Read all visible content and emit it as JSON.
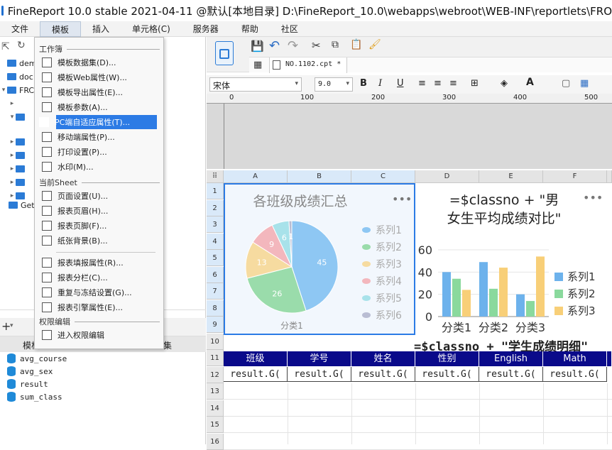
{
  "window": {
    "title": "FineReport 10.0 stable 2021-04-11 @默认[本地目录]    D:\\FineReport_10.0\\webapps\\webroot\\WEB-INF\\reportlets\\FRO"
  },
  "menubar": [
    "文件",
    "模板",
    "插入",
    "单元格(C)",
    "服务器",
    "帮助",
    "社区"
  ],
  "tree": [
    {
      "label": "dem"
    },
    {
      "label": "doc"
    },
    {
      "label": "FRC"
    },
    {
      "label": ""
    },
    {
      "label": ""
    },
    {
      "label": ""
    },
    {
      "label": ""
    },
    {
      "label": ""
    },
    {
      "label": ""
    },
    {
      "label": ""
    },
    {
      "label": "Get"
    }
  ],
  "datasets": {
    "tab1": "模板",
    "tab2": "集",
    "items": [
      "avg_course",
      "avg_sex",
      "result",
      "sum_class"
    ]
  },
  "dropdown": {
    "sections": [
      "工作簿",
      "当前Sheet",
      "权限编辑"
    ],
    "workbook_items": [
      {
        "label": "模板数据集(D)...",
        "icon": "database-icon"
      },
      {
        "label": "模板Web属性(W)...",
        "icon": "globe-icon"
      },
      {
        "label": "模板导出属性(E)...",
        "icon": "export-icon"
      },
      {
        "label": "模板参数(A)...",
        "icon": "param-icon"
      },
      {
        "label": "PC端自适应属性(T)...",
        "icon": "resize-icon"
      },
      {
        "label": "移动端属性(P)...",
        "icon": "mobile-icon"
      },
      {
        "label": "打印设置(P)...",
        "icon": "printer-icon"
      },
      {
        "label": "水印(M)...",
        "icon": "stamp-icon"
      }
    ],
    "sheet_items": [
      {
        "label": "页面设置(U)...",
        "icon": "page-icon"
      },
      {
        "label": "报表页眉(H)...",
        "icon": "header-icon"
      },
      {
        "label": "报表页脚(F)...",
        "icon": "footer-icon"
      },
      {
        "label": "纸张背景(B)...",
        "icon": "image-icon"
      },
      {
        "label": "报表填报属性(R)...",
        "icon": "form-icon"
      },
      {
        "label": "报表分栏(C)...",
        "icon": "columns-icon"
      },
      {
        "label": "重复与冻结设置(G)...",
        "icon": "freeze-icon"
      },
      {
        "label": "报表引擎属性(E)...",
        "icon": "engine-icon"
      }
    ],
    "perm_items": [
      {
        "label": "进入权限编辑",
        "icon": "grid-icon"
      }
    ]
  },
  "editor": {
    "tab": "NO.1102.cpt *",
    "font": "宋体",
    "size": "9.0",
    "ruler": [
      "0",
      "100",
      "200",
      "300",
      "400",
      "500"
    ]
  },
  "columns": [
    "A",
    "B",
    "C",
    "D",
    "E",
    "F"
  ],
  "rows": [
    "1",
    "2",
    "3",
    "4",
    "5",
    "6",
    "7",
    "8",
    "9",
    "10",
    "11",
    "12",
    "13",
    "14",
    "15",
    "16"
  ],
  "cells": {
    "title_formula": "=$classno + \"学生成绩明细\"",
    "headers": [
      "班级",
      "学号",
      "姓名",
      "性别",
      "English",
      "Math"
    ],
    "data": [
      "result.G(",
      "result.G(",
      "result.G(",
      "result.G(",
      "result.G(",
      "result.G("
    ]
  },
  "chart_data": [
    {
      "type": "pie",
      "title": "各班级成绩汇总",
      "categories": [
        "系列1",
        "系列2",
        "系列3",
        "系列4",
        "系列5",
        "系列6"
      ],
      "values": [
        45,
        26,
        13,
        9,
        6,
        1
      ],
      "xlabel": "分类1",
      "colors": [
        "#8ec7f3",
        "#9adcab",
        "#f6dba0",
        "#f3b7bd",
        "#a8e2ea",
        "#b9bdd3"
      ],
      "legend": "right"
    },
    {
      "type": "bar",
      "title": "=$classno + \"男女生平均成绩对比\"",
      "categories": [
        "分类1",
        "分类2",
        "分类3"
      ],
      "series": [
        {
          "name": "系列1",
          "values": [
            40,
            49,
            20
          ]
        },
        {
          "name": "系列2",
          "values": [
            34,
            25,
            14
          ]
        },
        {
          "name": "系列3",
          "values": [
            24,
            44,
            54
          ]
        }
      ],
      "ylim": [
        0,
        60
      ],
      "yticks": [
        "0",
        "20",
        "40",
        "60"
      ],
      "colors": [
        "#6db2ec",
        "#8ad99d",
        "#f8cf78"
      ],
      "legend": "right"
    }
  ]
}
